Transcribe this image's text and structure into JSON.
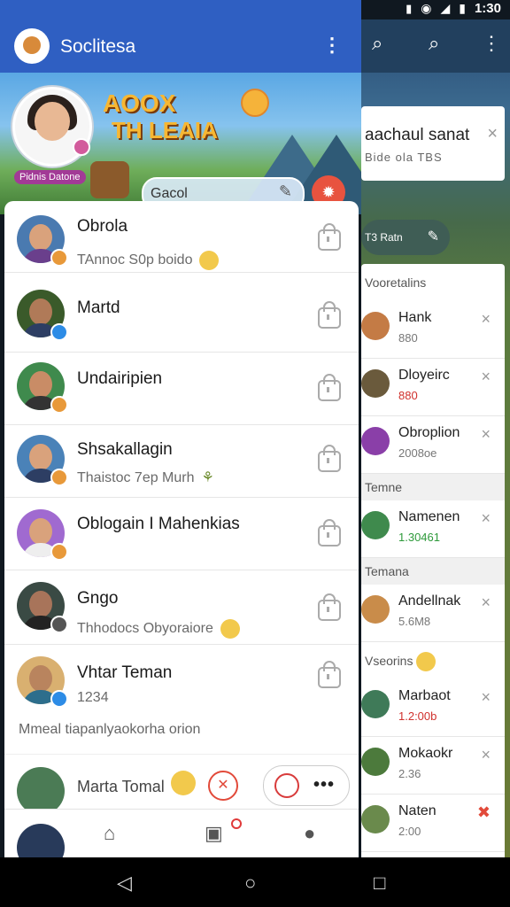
{
  "status_bar": {
    "time": "1:30"
  },
  "app": {
    "title": "Soclitesa"
  },
  "banner": {
    "title_line1": "AOOX",
    "title_line2": "TH LEAIA",
    "profile_caption": "Pidnis Datone",
    "search_text": "Gacol"
  },
  "chats": [
    {
      "name": "Obrola",
      "preview": "TAnnoc S0p boido",
      "badge_color": "#e8993a",
      "avatar_bg": "#4a7ab0"
    },
    {
      "name": "Martd",
      "preview": "",
      "badge_color": "#2d8ce6",
      "avatar_bg": "#3a5a2a"
    },
    {
      "name": "Undairipien",
      "preview": "",
      "badge_color": "#e8993a",
      "avatar_bg": "#3f8a4d"
    },
    {
      "name": "Shsakallagin",
      "preview": "Thaistoc 7ep Murh",
      "badge_color": "#e8993a",
      "avatar_bg": "#4a82b8"
    },
    {
      "name": "Oblogain I Mahenkias",
      "preview": "",
      "badge_color": "#e8993a",
      "avatar_bg": "#a06ad0"
    },
    {
      "name": "Gngo",
      "preview": "Thhodocs Obyoraiore",
      "badge_color": "#555",
      "avatar_bg": "#3a4a44"
    },
    {
      "name": "Vhtar Teman",
      "preview": "1234",
      "badge_color": "#2d8ce6",
      "avatar_bg": "#d9b070"
    }
  ],
  "footer": {
    "note": "Mmeal tiapanlyaokorha orion",
    "last_name": "Marta Tomal"
  },
  "background": {
    "notification_title": "aachaul sanat",
    "notification_sub": "Bide ola TBS",
    "search_text": "T3 Ratn",
    "section1": "Vooretalins",
    "section2": "Temne",
    "section3": "Temana",
    "section4": "Vseorins",
    "items": [
      {
        "name": "Hank",
        "sub": "880",
        "sub_style": "",
        "avatar_bg": "#c47b45"
      },
      {
        "name": "Dloyeirc",
        "sub": "880",
        "sub_style": "red",
        "avatar_bg": "#6a5a3c"
      },
      {
        "name": "Obroplion",
        "sub": "2008oe",
        "sub_style": "",
        "avatar_bg": "#8a3fa8"
      },
      {
        "name": "Namenen",
        "sub": "1.30461",
        "sub_style": "green",
        "avatar_bg": "#3f8a4d"
      },
      {
        "name": "Andellnak",
        "sub": "5.6M8",
        "sub_style": "",
        "avatar_bg": "#c98c4a"
      },
      {
        "name": "Marbaot",
        "sub": "1.2:00b",
        "sub_style": "red",
        "avatar_bg": "#3f7a58"
      },
      {
        "name": "Mokaokr",
        "sub": "2.36",
        "sub_style": "",
        "avatar_bg": "#4c7a3c"
      },
      {
        "name": "Naten",
        "sub": "2:00",
        "sub_style": "",
        "avatar_bg": "#6a8a4c"
      }
    ]
  },
  "icons": {
    "more": "⋮",
    "search": "⌕",
    "edit": "✎",
    "close": "×",
    "home": "⌂",
    "camera": "▣",
    "profile": "●",
    "back": "◁",
    "home_sys": "○",
    "recents": "□"
  }
}
